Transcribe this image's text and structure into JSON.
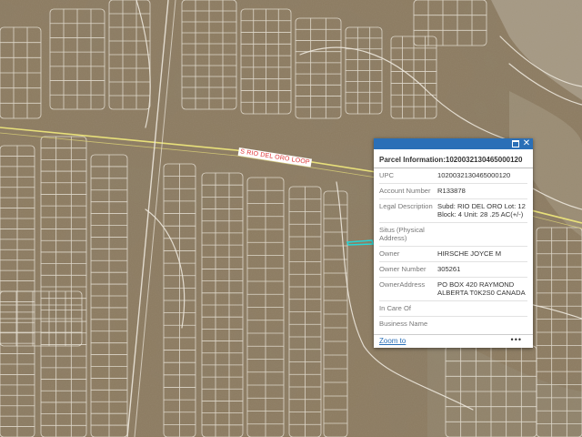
{
  "map": {
    "road_label": "S RIO DEL ORO LOOP",
    "colors": {
      "ground": "#8b7a5e",
      "parcel_line": "#ece7dc",
      "major_road": "#e8e07a",
      "highlight": "#29d6d6"
    }
  },
  "popup": {
    "header_color": "#2a6fb7",
    "maximize_icon": "maximize-icon",
    "close_icon": "close-icon",
    "close_glyph": "✕",
    "title": "Parcel Information:1020032130465000120",
    "fields": [
      {
        "label": "UPC",
        "value": "1020032130465000120"
      },
      {
        "label": "Account Number",
        "value": "R133878"
      },
      {
        "label": "Legal Description",
        "value": "Subd: RIO DEL ORO Lot: 12 Block: 4 Unit: 28 .25 AC(+/-)"
      },
      {
        "label": "Situs (Physical Address)",
        "value": ""
      },
      {
        "label": "Owner",
        "value": "HIRSCHE JOYCE M"
      },
      {
        "label": "Owner Number",
        "value": "305261"
      },
      {
        "label": "OwnerAddress",
        "value": "PO BOX 420 RAYMOND ALBERTA T0K2S0 CANADA"
      },
      {
        "label": "In Care Of",
        "value": ""
      },
      {
        "label": "Business Name",
        "value": ""
      }
    ],
    "zoom_label": "Zoom to",
    "more_label": "•••"
  }
}
